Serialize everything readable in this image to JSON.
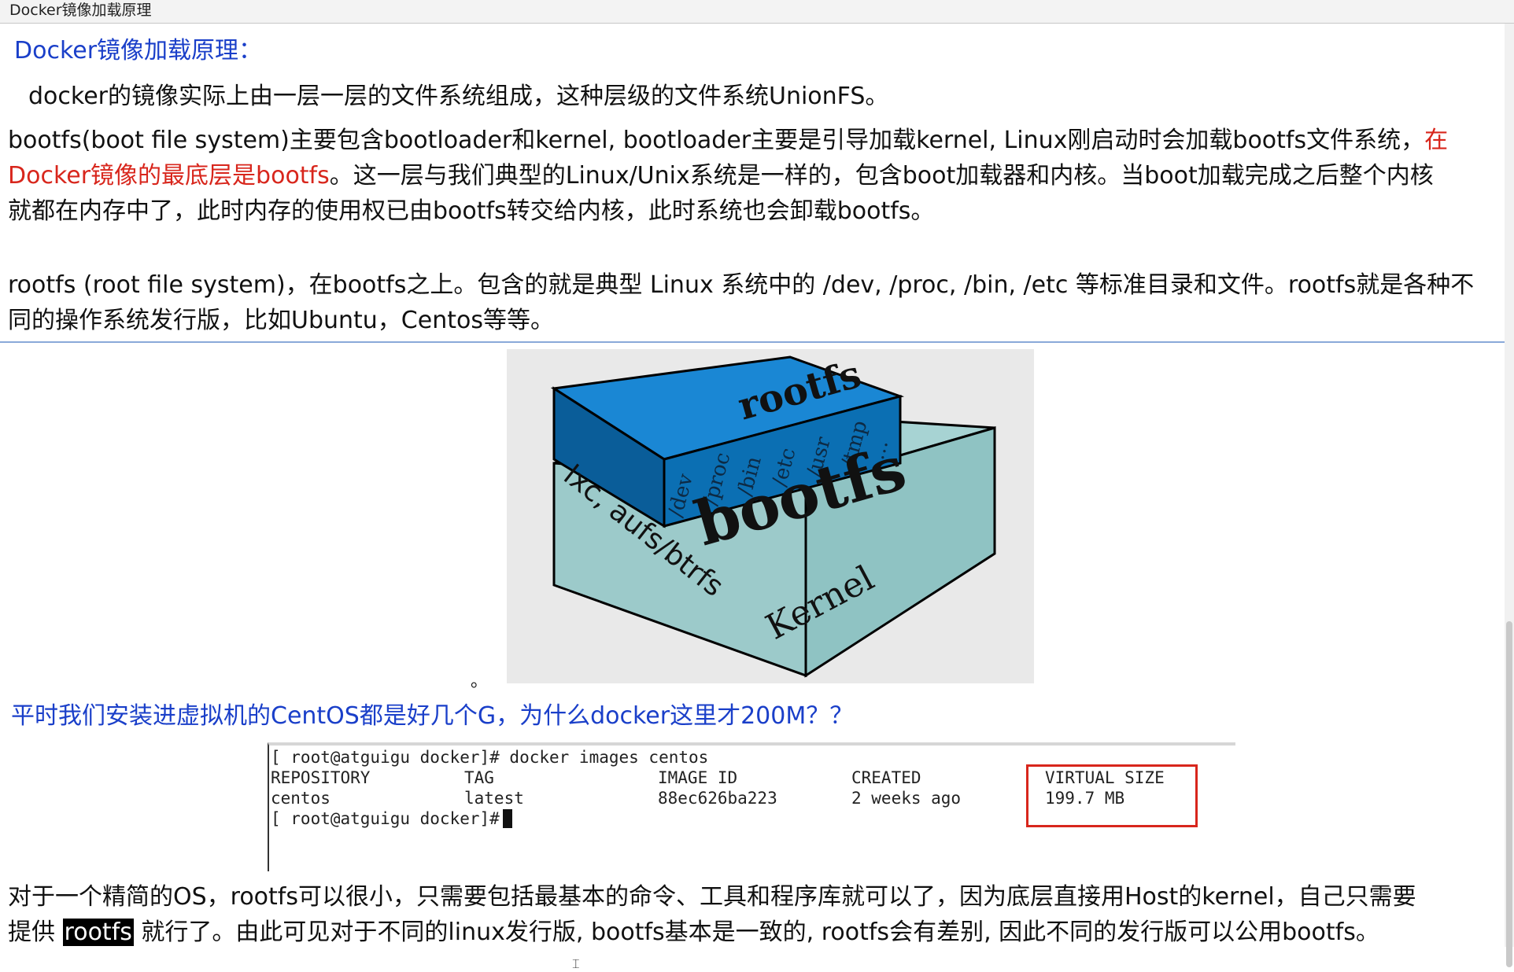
{
  "window": {
    "title": "Docker镜像加载原理"
  },
  "heading": "Docker镜像加载原理：",
  "intro": "docker的镜像实际上由一层一层的文件系统组成，这种层级的文件系统UnionFS。",
  "bootfs_paragraph": {
    "line1_a": "bootfs(boot file system)主要包含bootloader和kernel, bootloader主要是引导加载kernel, Linux刚启动时会加载bootfs文件系统，",
    "line1_red": "在",
    "line2_red": "Docker镜像的最底层是bootfs",
    "line2_b": "。这一层与我们典型的Linux/Unix系统是一样的，包含boot加载器和内核。当boot加载完成之后整个内核",
    "line3": "就都在内存中了，此时内存的使用权已由bootfs转交给内核，此时系统也会卸载bootfs。"
  },
  "rootfs_paragraph": {
    "line1": "rootfs (root file system)，在bootfs之上。包含的就是典型 Linux 系统中的 /dev, /proc, /bin, /etc 等标准目录和文件。rootfs就是各种不",
    "line2": "同的操作系统发行版，比如Ubuntu，Centos等等。"
  },
  "diagram": {
    "top_label": "rootfs",
    "dirs": [
      "/dev",
      "/proc",
      "/bin",
      "/etc",
      "/usr",
      "/tmp",
      "..."
    ],
    "bottom_label": "bootfs",
    "side_label": "lxc, aufs/btrfs",
    "kernel_label": "Kernel",
    "colors": {
      "rootfs_top": "#1a87d4",
      "rootfs_front": "#0b6fb3",
      "bootfs_top": "#a7d3d3",
      "bootfs_front": "#8fc3c3"
    }
  },
  "dot": "。",
  "question": "平时我们安装进虚拟机的CentOS都是好几个G，为什么docker这里才200M？？",
  "terminal": {
    "cmd": "[ root@atguigu docker]# docker images centos",
    "headers": [
      "REPOSITORY",
      "TAG",
      "IMAGE ID",
      "CREATED",
      "VIRTUAL SIZE"
    ],
    "row": [
      "centos",
      "latest",
      "88ec626ba223",
      "2 weeks ago",
      "199.7 MB"
    ],
    "prompt": "[ root@atguigu docker]#",
    "highlight_color": "#d8261c"
  },
  "conclusion": {
    "line1": "对于一个精简的OS，rootfs可以很小，只需要包括最基本的命令、工具和程序库就可以了，因为底层直接用Host的kernel，自己只需要",
    "line2_a": "提供 ",
    "chip": "rootfs",
    "line2_b": " 就行了。由此可见对于不同的linux发行版, bootfs基本是一致的, rootfs会有差别, 因此不同的发行版可以公用bootfs。"
  }
}
